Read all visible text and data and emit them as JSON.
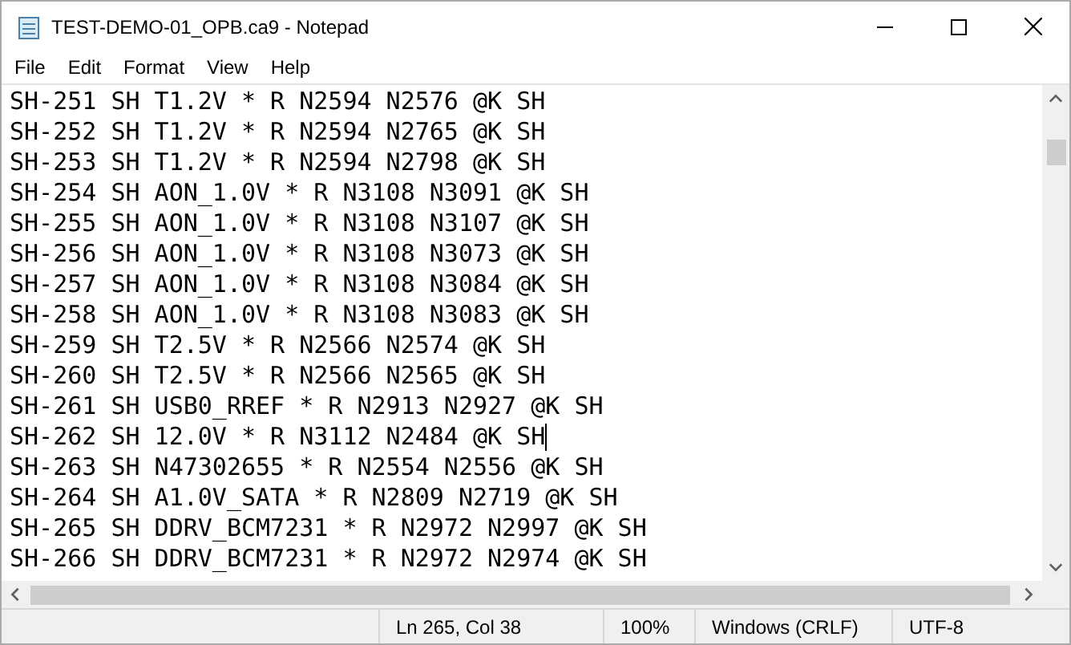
{
  "window": {
    "title": "TEST-DEMO-01_OPB.ca9 - Notepad"
  },
  "menu": [
    "File",
    "Edit",
    "Format",
    "View",
    "Help"
  ],
  "lines": [
    {
      "text": "SH-251 SH T1.2V * R N2594 N2576 @K SH",
      "caret": false
    },
    {
      "text": "SH-252 SH T1.2V * R N2594 N2765 @K SH",
      "caret": false
    },
    {
      "text": "SH-253 SH T1.2V * R N2594 N2798 @K SH",
      "caret": false
    },
    {
      "text": "SH-254 SH AON_1.0V * R N3108 N3091 @K SH",
      "caret": false
    },
    {
      "text": "SH-255 SH AON_1.0V * R N3108 N3107 @K SH",
      "caret": false
    },
    {
      "text": "SH-256 SH AON_1.0V * R N3108 N3073 @K SH",
      "caret": false
    },
    {
      "text": "SH-257 SH AON_1.0V * R N3108 N3084 @K SH",
      "caret": false
    },
    {
      "text": "SH-258 SH AON_1.0V * R N3108 N3083 @K SH",
      "caret": false
    },
    {
      "text": "SH-259 SH T2.5V * R N2566 N2574 @K SH",
      "caret": false
    },
    {
      "text": "SH-260 SH T2.5V * R N2566 N2565 @K SH",
      "caret": false
    },
    {
      "text": "SH-261 SH USB0_RREF * R N2913 N2927 @K SH",
      "caret": false
    },
    {
      "text": "SH-262 SH 12.0V * R N3112 N2484 @K SH",
      "caret": true
    },
    {
      "text": "SH-263 SH N47302655 * R N2554 N2556 @K SH",
      "caret": false
    },
    {
      "text": "SH-264 SH A1.0V_SATA * R N2809 N2719 @K SH",
      "caret": false
    },
    {
      "text": "SH-265 SH DDRV_BCM7231 * R N2972 N2997 @K SH",
      "caret": false
    },
    {
      "text": "SH-266 SH DDRV_BCM7231 * R N2972 N2974 @K SH",
      "caret": false
    }
  ],
  "status_bar": [
    "Ln 265, Col 38",
    "100%",
    "Windows (CRLF)",
    "UTF-8"
  ]
}
